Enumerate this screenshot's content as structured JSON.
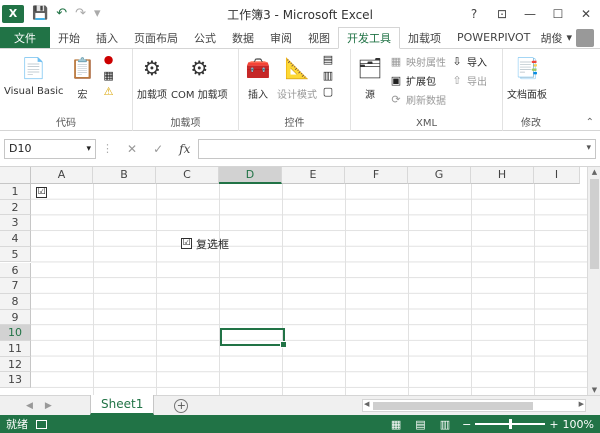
{
  "window": {
    "title": "工作簿3 - Microsoft Excel",
    "app_logo": "X",
    "controls": [
      "?",
      "⊡",
      "—",
      "☐",
      "✕"
    ]
  },
  "quick_access": {
    "icons": [
      "save-icon",
      "undo-icon",
      "redo-icon",
      "customize-icon"
    ]
  },
  "tabs": [
    {
      "label": "文件"
    },
    {
      "label": "开始"
    },
    {
      "label": "插入"
    },
    {
      "label": "页面布局"
    },
    {
      "label": "公式"
    },
    {
      "label": "数据"
    },
    {
      "label": "审阅"
    },
    {
      "label": "视图"
    },
    {
      "label": "开发工具"
    },
    {
      "label": "加载项"
    },
    {
      "label": "POWERPIVOT"
    }
  ],
  "user": {
    "name": "胡俊"
  },
  "ribbon": {
    "code": {
      "label": "代码",
      "visual_basic": "Visual Basic",
      "macro": "宏"
    },
    "addins": {
      "label": "加载项",
      "addin": "加载项",
      "com_addin": "COM 加载项"
    },
    "controls": {
      "label": "控件",
      "insert": "插入",
      "design_mode": "设计模式"
    },
    "xml": {
      "label": "XML",
      "source": "源",
      "map_props": "映射属性",
      "expansion": "扩展包",
      "refresh": "刷新数据",
      "import": "导入",
      "export": "导出"
    },
    "modify": {
      "label": "修改",
      "doc_panel": "文档面板"
    }
  },
  "formula_bar": {
    "name_box": "D10",
    "fx": "fx",
    "cancel": "✕",
    "enter": "✓",
    "value": ""
  },
  "grid": {
    "columns": [
      "A",
      "B",
      "C",
      "D",
      "E",
      "F",
      "G",
      "H",
      "I"
    ],
    "rows": [
      "1",
      "2",
      "3",
      "4",
      "5",
      "6",
      "7",
      "8",
      "9",
      "10",
      "11",
      "12",
      "13"
    ],
    "checkbox_a1": "☑",
    "checkbox_label": "复选框",
    "checkbox_mark": "☑"
  },
  "sheets": {
    "active": "Sheet1",
    "add": "+"
  },
  "status": {
    "text": "就绪",
    "zoom": "100%",
    "zoom_minus": "−",
    "zoom_plus": "+"
  },
  "colors": {
    "accent": "#217346"
  }
}
